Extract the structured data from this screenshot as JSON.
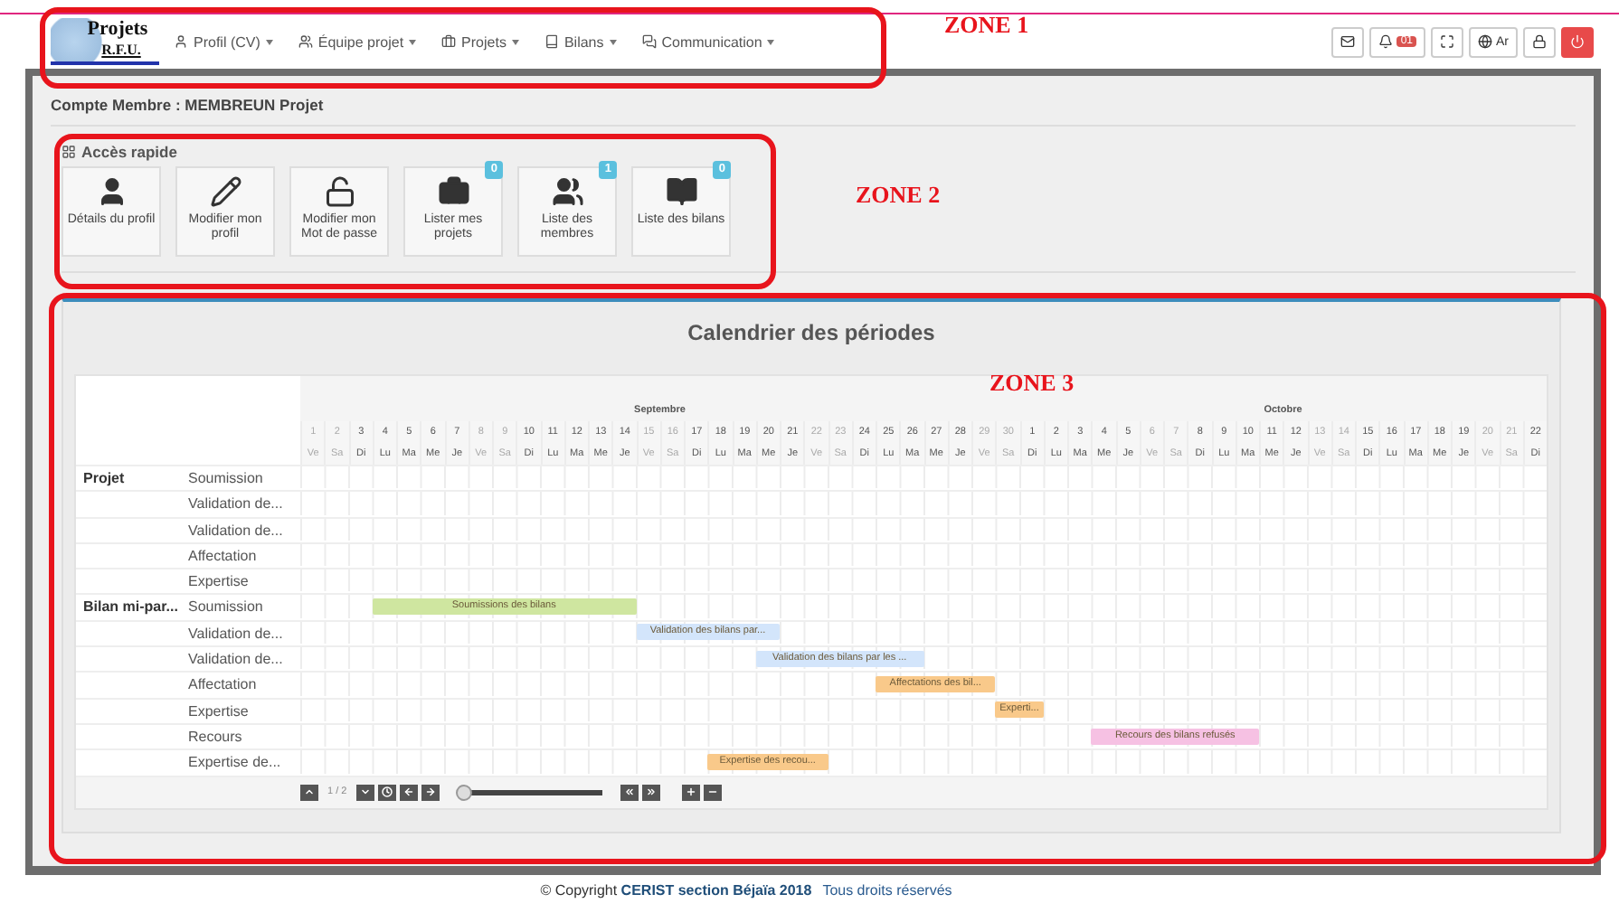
{
  "nav": {
    "logo": {
      "line1": "Projets",
      "line2": "R.F.U."
    },
    "menus": [
      {
        "label": "Profil (CV)"
      },
      {
        "label": "Équipe projet"
      },
      {
        "label": "Projets"
      },
      {
        "label": "Bilans"
      },
      {
        "label": "Communication"
      }
    ],
    "actions": [
      {
        "kind": "plain"
      },
      {
        "kind": "plain",
        "badge": "01"
      },
      {
        "kind": "plain"
      },
      {
        "kind": "plain",
        "label": "Ar"
      },
      {
        "kind": "plain"
      },
      {
        "kind": "danger"
      }
    ]
  },
  "breadcrumb": "Compte Membre : MEMBREUN Projet",
  "quick_access": {
    "title": "Accès rapide",
    "tiles": [
      {
        "label": "Détails du profil"
      },
      {
        "label": "Modifier mon profil"
      },
      {
        "label": "Modifier mon Mot de passe"
      },
      {
        "label": "Lister mes projets",
        "badge": "0"
      },
      {
        "label": "Liste des membres",
        "badge": "1"
      },
      {
        "label": "Liste des bilans",
        "badge": "0"
      }
    ]
  },
  "calendar": {
    "title": "Calendrier des périodes",
    "months": [
      {
        "label": "Septembre",
        "days": [
          {
            "day": "1",
            "weekday": "Ve",
            "weekend": true
          },
          {
            "day": "2",
            "weekday": "Sa",
            "weekend": true
          },
          {
            "day": "3",
            "weekday": "Di",
            "weekend": false
          },
          {
            "day": "4",
            "weekday": "Lu",
            "weekend": false
          },
          {
            "day": "5",
            "weekday": "Ma",
            "weekend": false
          },
          {
            "day": "6",
            "weekday": "Me",
            "weekend": false
          },
          {
            "day": "7",
            "weekday": "Je",
            "weekend": false
          },
          {
            "day": "8",
            "weekday": "Ve",
            "weekend": true
          },
          {
            "day": "9",
            "weekday": "Sa",
            "weekend": true
          },
          {
            "day": "10",
            "weekday": "Di",
            "weekend": false
          },
          {
            "day": "11",
            "weekday": "Lu",
            "weekend": false
          },
          {
            "day": "12",
            "weekday": "Ma",
            "weekend": false
          },
          {
            "day": "13",
            "weekday": "Me",
            "weekend": false
          },
          {
            "day": "14",
            "weekday": "Je",
            "weekend": false
          },
          {
            "day": "15",
            "weekday": "Ve",
            "weekend": true
          },
          {
            "day": "16",
            "weekday": "Sa",
            "weekend": true
          },
          {
            "day": "17",
            "weekday": "Di",
            "weekend": false
          },
          {
            "day": "18",
            "weekday": "Lu",
            "weekend": false
          },
          {
            "day": "19",
            "weekday": "Ma",
            "weekend": false
          },
          {
            "day": "20",
            "weekday": "Me",
            "weekend": false
          },
          {
            "day": "21",
            "weekday": "Je",
            "weekend": false
          },
          {
            "day": "22",
            "weekday": "Ve",
            "weekend": true
          },
          {
            "day": "23",
            "weekday": "Sa",
            "weekend": true
          },
          {
            "day": "24",
            "weekday": "Di",
            "weekend": false
          },
          {
            "day": "25",
            "weekday": "Lu",
            "weekend": false
          },
          {
            "day": "26",
            "weekday": "Ma",
            "weekend": false
          },
          {
            "day": "27",
            "weekday": "Me",
            "weekend": false
          },
          {
            "day": "28",
            "weekday": "Je",
            "weekend": false
          },
          {
            "day": "29",
            "weekday": "Ve",
            "weekend": true
          },
          {
            "day": "30",
            "weekday": "Sa",
            "weekend": true
          }
        ]
      },
      {
        "label": "Octobre",
        "days": [
          {
            "day": "1",
            "weekday": "Di",
            "weekend": false
          },
          {
            "day": "2",
            "weekday": "Lu",
            "weekend": false
          },
          {
            "day": "3",
            "weekday": "Ma",
            "weekend": false
          },
          {
            "day": "4",
            "weekday": "Me",
            "weekend": false
          },
          {
            "day": "5",
            "weekday": "Je",
            "weekend": false
          },
          {
            "day": "6",
            "weekday": "Ve",
            "weekend": true
          },
          {
            "day": "7",
            "weekday": "Sa",
            "weekend": true
          },
          {
            "day": "8",
            "weekday": "Di",
            "weekend": false
          },
          {
            "day": "9",
            "weekday": "Lu",
            "weekend": false
          },
          {
            "day": "10",
            "weekday": "Ma",
            "weekend": false
          },
          {
            "day": "11",
            "weekday": "Me",
            "weekend": false
          },
          {
            "day": "12",
            "weekday": "Je",
            "weekend": false
          },
          {
            "day": "13",
            "weekday": "Ve",
            "weekend": true
          },
          {
            "day": "14",
            "weekday": "Sa",
            "weekend": true
          },
          {
            "day": "15",
            "weekday": "Di",
            "weekend": false
          },
          {
            "day": "16",
            "weekday": "Lu",
            "weekend": false
          },
          {
            "day": "17",
            "weekday": "Ma",
            "weekend": false
          },
          {
            "day": "18",
            "weekday": "Me",
            "weekend": false
          },
          {
            "day": "19",
            "weekday": "Je",
            "weekend": false
          },
          {
            "day": "20",
            "weekday": "Ve",
            "weekend": true
          },
          {
            "day": "21",
            "weekday": "Sa",
            "weekend": true
          },
          {
            "day": "22",
            "weekday": "Di",
            "weekend": false
          }
        ]
      }
    ],
    "rows": [
      {
        "group": "Projet",
        "label": "Soumission",
        "bars": []
      },
      {
        "label": "Validation de...",
        "bars": []
      },
      {
        "label": "Validation de...",
        "bars": []
      },
      {
        "label": "Affectation",
        "bars": []
      },
      {
        "label": "Expertise",
        "bars": []
      },
      {
        "group": "Bilan mi-par...",
        "label": "Soumission",
        "bars": [
          {
            "label": "Soumissions des bilans",
            "color": "#cfe6a0"
          }
        ]
      },
      {
        "label": "Validation de...",
        "bars": [
          {
            "label": "Validation des bilans par...",
            "color": "#d3e5fb"
          }
        ]
      },
      {
        "label": "Validation de...",
        "bars": [
          {
            "label": "Validation des bilans par les ...",
            "color": "#d3e5fb"
          }
        ]
      },
      {
        "label": "Affectation",
        "bars": [
          {
            "label": "Affectations des bil...",
            "color": "#f9c98a"
          }
        ]
      },
      {
        "label": "Expertise",
        "bars": [
          {
            "label": "Experti...",
            "color": "#f9c98a"
          }
        ]
      },
      {
        "label": "Recours",
        "bars": [
          {
            "label": "Recours des bilans refusés",
            "color": "#f6c1e3"
          }
        ]
      },
      {
        "label": "Expertise de...",
        "bars": [
          {
            "label": "Expertise des recou...",
            "color": "#f9c98a"
          }
        ]
      }
    ],
    "pager": "1 / 2",
    "zoom_slider": {
      "level": 0.04
    }
  },
  "footer": {
    "copyright": "© Copyright **CERIST section Béjaïa 2018**",
    "rights": "Tous droits réservés"
  },
  "annotations": [
    {
      "label": "ZONE 1"
    },
    {
      "label": "ZONE 2"
    },
    {
      "label": "ZONE 3"
    }
  ]
}
